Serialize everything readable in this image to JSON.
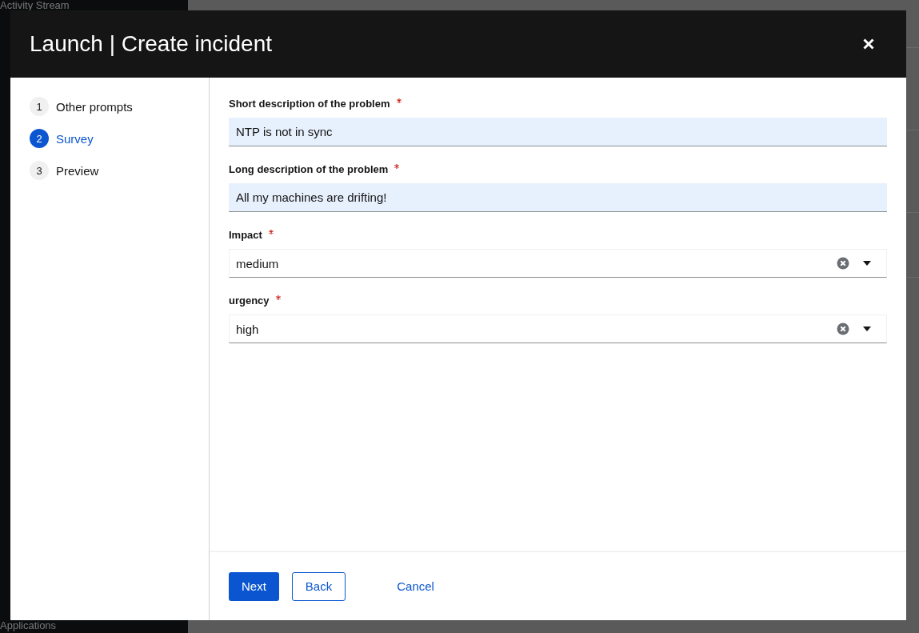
{
  "background": {
    "sidebar_items": [
      "Activity Stream",
      "Applications"
    ]
  },
  "dialog": {
    "title": "Launch | Create incident",
    "steps": [
      {
        "number": "1",
        "label": "Other prompts",
        "selected": false
      },
      {
        "number": "2",
        "label": "Survey",
        "selected": true
      },
      {
        "number": "3",
        "label": "Preview",
        "selected": false
      }
    ],
    "fields": [
      {
        "kind": "text",
        "label": "Short description of the problem",
        "required": true,
        "value": "NTP is not in sync"
      },
      {
        "kind": "text",
        "label": "Long description of the problem",
        "required": true,
        "value": "All my machines are drifting!"
      },
      {
        "kind": "select",
        "label": "Impact",
        "required": true,
        "value": "medium"
      },
      {
        "kind": "select",
        "label": "urgency",
        "required": true,
        "value": "high"
      }
    ],
    "buttons": [
      {
        "kind": "primary",
        "label": "Next"
      },
      {
        "kind": "secondary",
        "label": "Back"
      },
      {
        "kind": "link",
        "label": "Cancel"
      }
    ]
  }
}
